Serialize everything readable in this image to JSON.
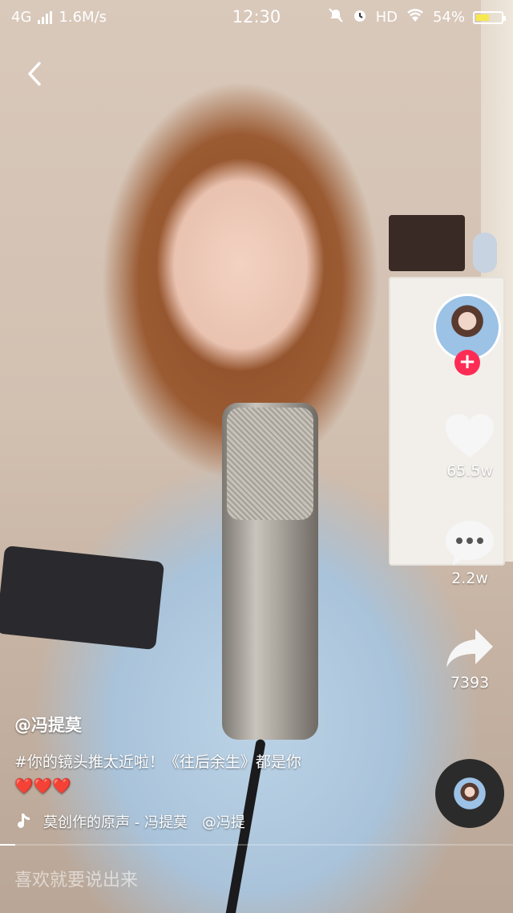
{
  "status_bar": {
    "network": "4G",
    "speed": "1.6M/s",
    "time": "12:30",
    "hd": "HD",
    "battery": "54%",
    "battery_level": 0.54,
    "battery_color": "#f6e84e"
  },
  "video": {
    "back_icon": "chevron-left-icon"
  },
  "rail": {
    "follow_symbol": "+",
    "follow_color": "#fe2c55",
    "like_count": "65.5w",
    "comment_count": "2.2w",
    "share_count": "7393"
  },
  "caption": {
    "author": "@冯提莫",
    "text": "#你的镜头推太近啦！《往后余生》都是你",
    "hearts": "❤️❤️❤️"
  },
  "music": {
    "label": "莫创作的原声 - 冯提莫　@冯提"
  },
  "playback": {
    "progress": 0.03
  },
  "comment_input": {
    "placeholder": "喜欢就要说出来"
  }
}
